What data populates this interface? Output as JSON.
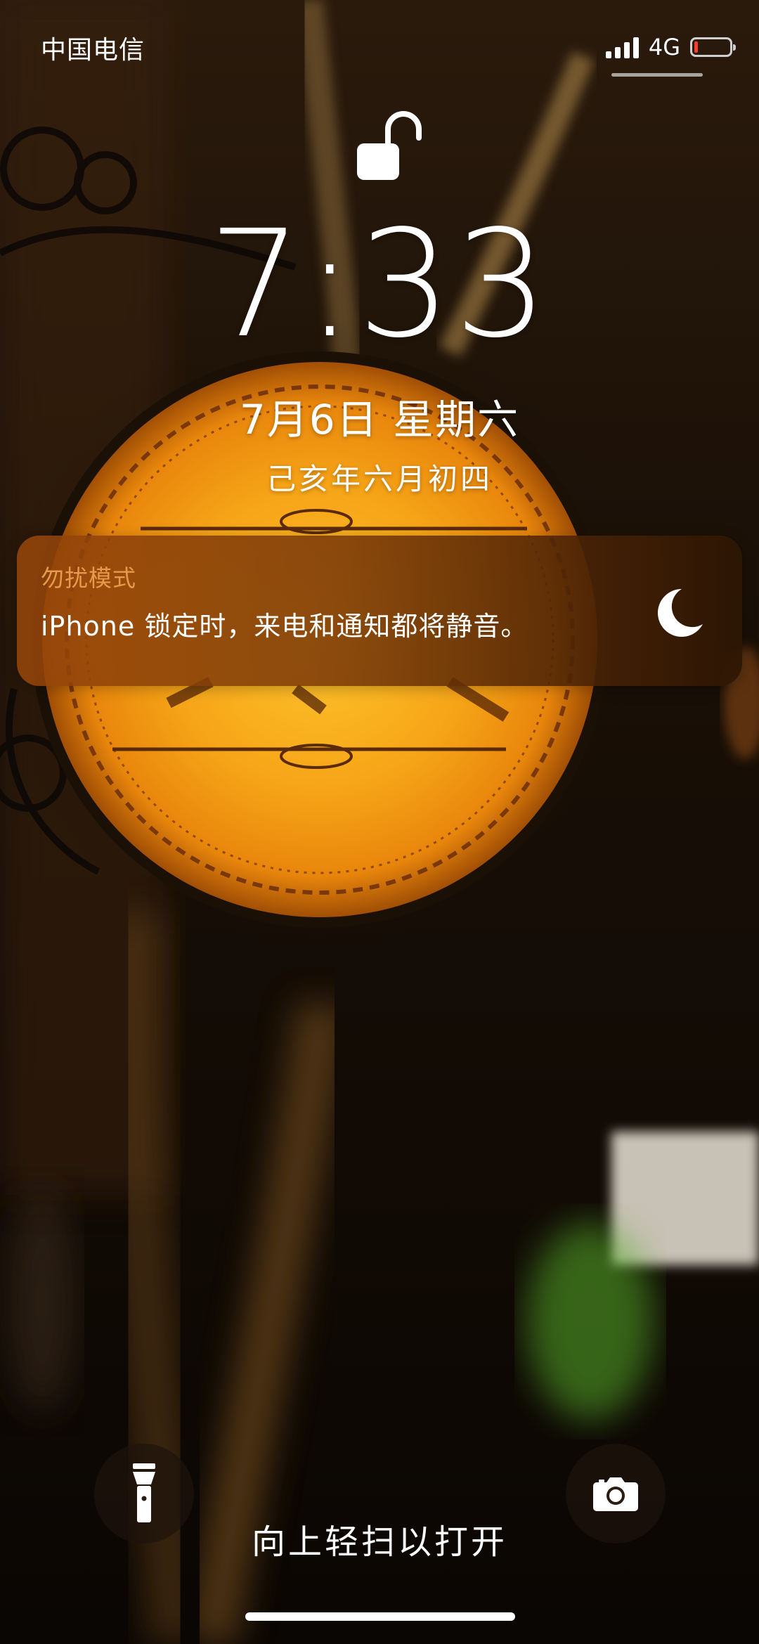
{
  "status_bar": {
    "carrier": "中国电信",
    "network": "4G",
    "battery_level": 0.1,
    "battery_color": "#ff3b30",
    "signal_bars": 4
  },
  "lockscreen": {
    "lock_state_icon": "unlocked-padlock-icon",
    "time": "7:33",
    "date": "7月6日 星期六",
    "lunar_date": "己亥年六月初四"
  },
  "notification": {
    "title": "勿扰模式",
    "body": "iPhone 锁定时，来电和通知都将静音。",
    "icon": "moon-icon",
    "title_color": "#e59a4c"
  },
  "bottom": {
    "flashlight_icon": "flashlight-icon",
    "camera_icon": "camera-icon",
    "swipe_hint": "向上轻扫以打开"
  }
}
